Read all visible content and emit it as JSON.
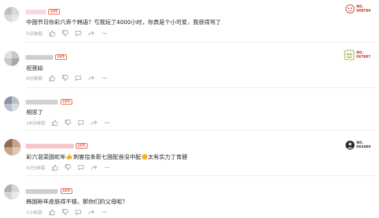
{
  "comments": [
    {
      "text": "中国节日你彩六弄个韩语？亏我玩了4000小时，你真是个小可爱，我很得骂了",
      "time": "5分钟前",
      "badge": {
        "line1": "NO.",
        "line2": "008789"
      },
      "level": "LV5"
    },
    {
      "text": "祝褒姒",
      "time": "9分钟前",
      "badge": {
        "line1": "NO.",
        "line2": "007887"
      },
      "level": "LV5"
    },
    {
      "text": "相思了",
      "time": "18分钟前",
      "level": "LV5"
    },
    {
      "text_a": "彩六混菜国蛇年",
      "text_b": "刺客信条影七国配音没中配",
      "text_c": "太有实力了育碧",
      "time": "43分钟前",
      "badge": {
        "line1": "NO.",
        "line2": "002489"
      },
      "level": "LV5"
    },
    {
      "text": "韩国新年皮肤得不错，那你们的父母呢？",
      "time": "1小时前",
      "level": "LV5"
    }
  ],
  "colors": {
    "level_badge": "#e8603c",
    "meta_text": "#9a9a9a",
    "divider": "#ececec"
  },
  "icons": [
    "thumbs-up-icon",
    "thumbs-down-icon",
    "reply-icon",
    "share-icon",
    "more-icon"
  ]
}
